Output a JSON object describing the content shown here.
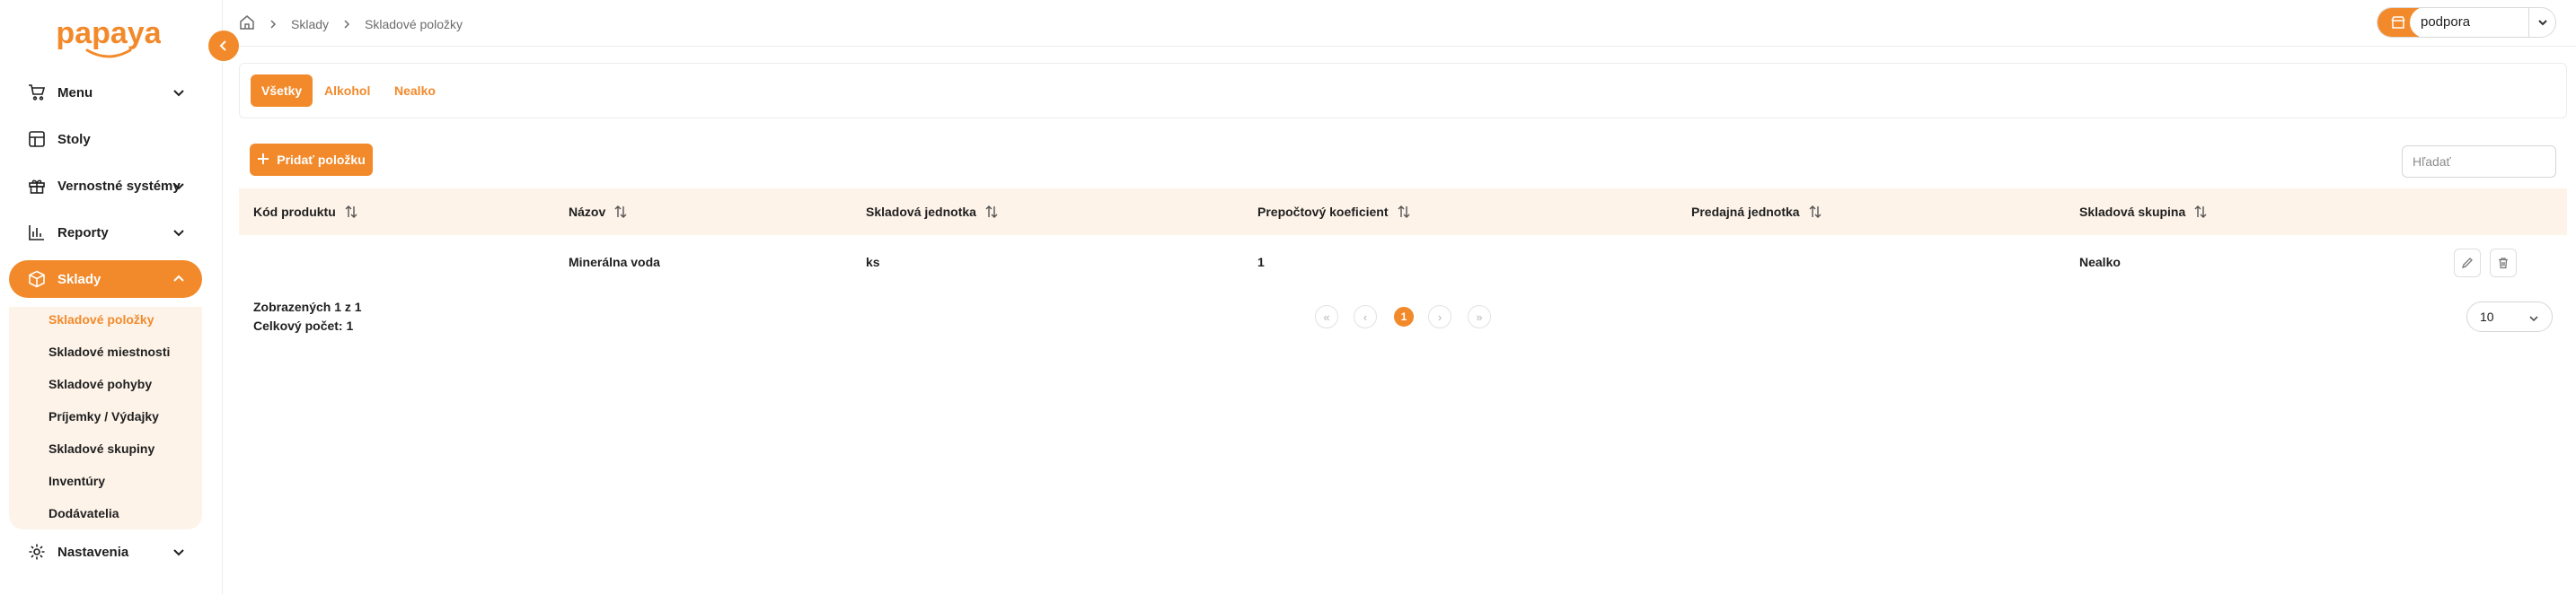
{
  "brand": {
    "logo_text": "papaya",
    "accent": "#f28a2b",
    "submenu_bg": "#fdf3e9"
  },
  "sidebar": {
    "items": [
      {
        "label": "Menu",
        "icon": "cart-icon",
        "has_chevron": true
      },
      {
        "label": "Stoly",
        "icon": "table-grid-icon",
        "has_chevron": false
      },
      {
        "label": "Vernostné systémy",
        "icon": "gift-icon",
        "has_chevron": true
      },
      {
        "label": "Reporty",
        "icon": "bar-chart-icon",
        "has_chevron": true
      },
      {
        "label": "Sklady",
        "icon": "box-icon",
        "has_chevron": true,
        "active": true
      },
      {
        "label": "Nastavenia",
        "icon": "gear-icon",
        "has_chevron": true
      }
    ],
    "submenu": [
      {
        "label": "Skladové položky",
        "active": true
      },
      {
        "label": "Skladové miestnosti"
      },
      {
        "label": "Skladové pohyby"
      },
      {
        "label": "Príjemky / Výdajky"
      },
      {
        "label": "Skladové skupiny"
      },
      {
        "label": "Inventúry"
      },
      {
        "label": "Dodávatelia"
      }
    ]
  },
  "header": {
    "breadcrumb": [
      "Sklady",
      "Skladové položky"
    ],
    "user": "podpora"
  },
  "tabs": [
    {
      "label": "Všetky",
      "active": true
    },
    {
      "label": "Alkohol"
    },
    {
      "label": "Nealko"
    }
  ],
  "toolbar": {
    "add_label": "Pridať položku",
    "search_placeholder": "Hľadať"
  },
  "table": {
    "columns": [
      "Kód produktu",
      "Názov",
      "Skladová jednotka",
      "Prepočtový koeficient",
      "Predajná jednotka",
      "Skladová skupina"
    ],
    "rows": [
      {
        "code": "",
        "name": "Minerálna voda",
        "unit": "ks",
        "coef": "1",
        "sale_unit": "",
        "group": "Nealko"
      }
    ]
  },
  "footer": {
    "shown": "Zobrazených 1 z 1",
    "total": "Celkový počet: 1",
    "pager": {
      "first": "«",
      "prev": "‹",
      "current": "1",
      "next": "›",
      "last": "»"
    },
    "page_size": "10"
  }
}
